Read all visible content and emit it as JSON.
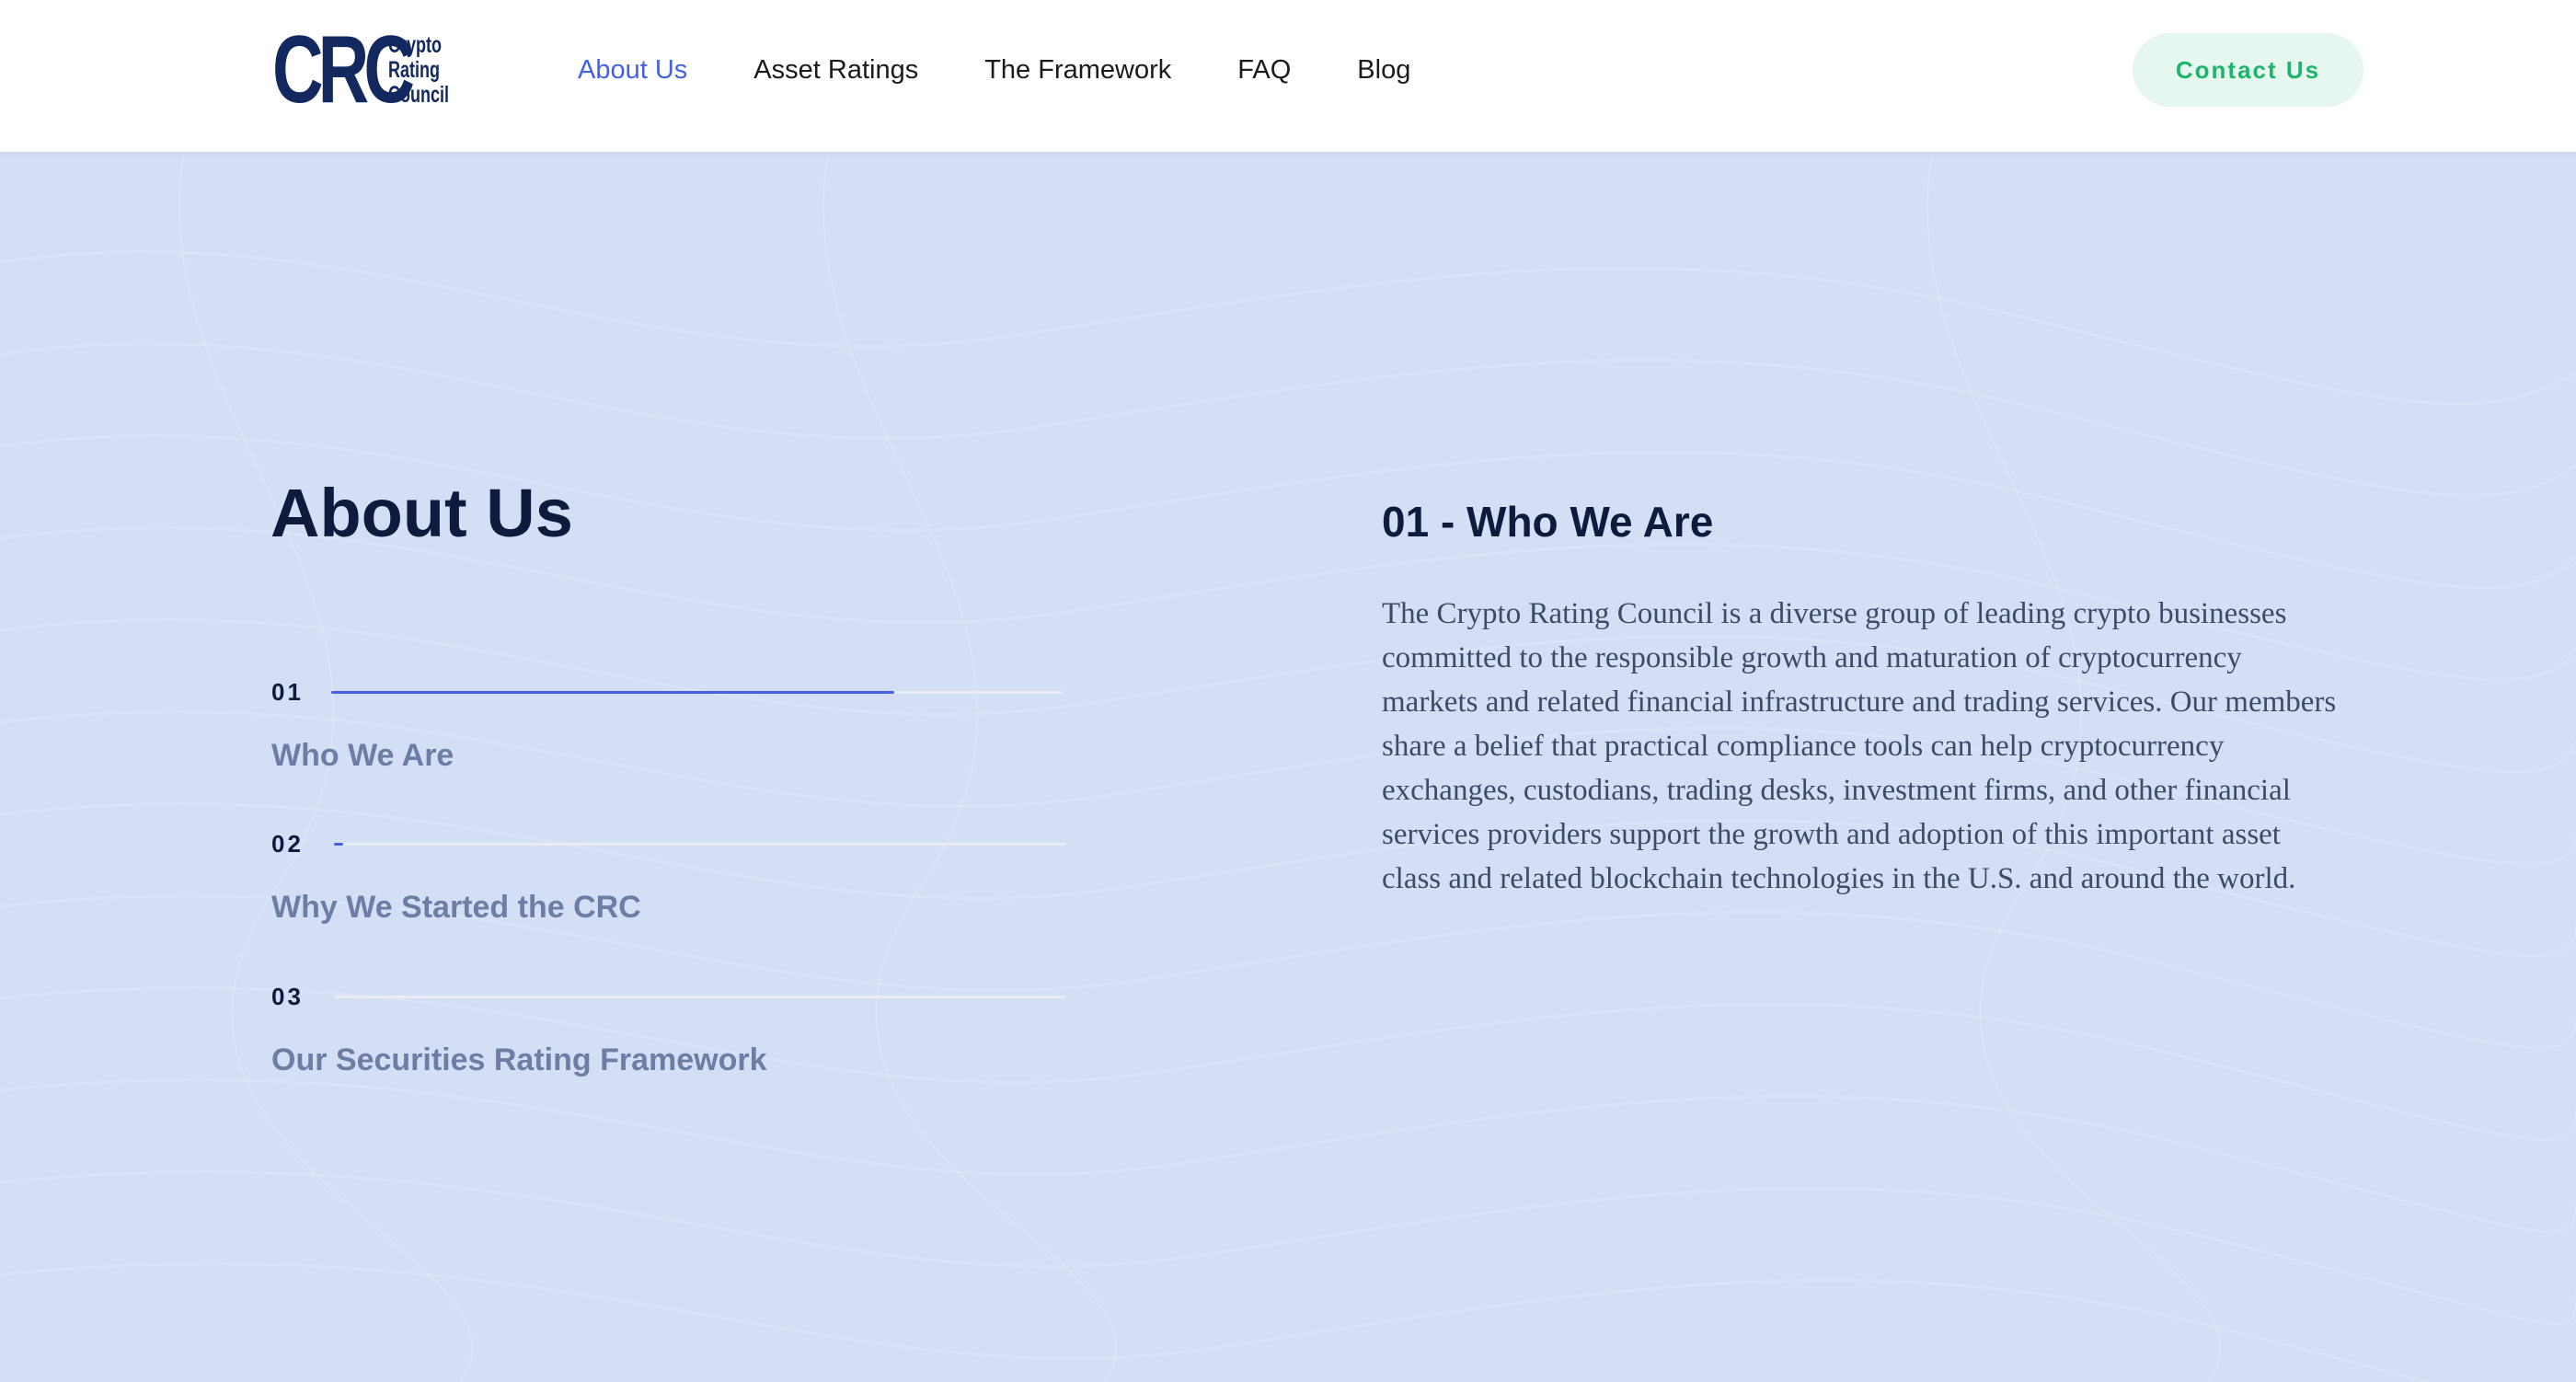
{
  "header": {
    "logo": {
      "mark": "CRC",
      "words": [
        "Crypto",
        "Rating",
        "Council"
      ]
    },
    "nav": [
      {
        "label": "About Us",
        "active": true
      },
      {
        "label": "Asset Ratings",
        "active": false
      },
      {
        "label": "The Framework",
        "active": false
      },
      {
        "label": "FAQ",
        "active": false
      },
      {
        "label": "Blog",
        "active": false
      }
    ],
    "contact_label": "Contact Us"
  },
  "main": {
    "title": "About Us",
    "steps": [
      {
        "number": "01",
        "label": "Who We Are",
        "progress": 0.77
      },
      {
        "number": "02",
        "label": "Why We Started the CRC",
        "progress": 0.01
      },
      {
        "number": "03",
        "label": "Our Securities Rating Framework",
        "progress": 0
      }
    ],
    "section": {
      "title": "01 - Who We Are",
      "body": "The Crypto Rating Council is a diverse group of leading crypto businesses committed to the responsible growth and maturation of cryptocurrency markets and related financial infrastructure and trading services. Our members share a belief that practical compliance tools can help cryptocurrency exchanges, custodians, trading desks, investment firms, and other financial services providers support the growth and adoption of this important asset class and related blockchain technologies in the U.S. and around the world."
    }
  },
  "colors": {
    "background": "#d4dff6",
    "accent": "#4461e6",
    "brand": "#13285e",
    "contact_bg": "#e6f7ef",
    "contact_text": "#1fb46b"
  }
}
